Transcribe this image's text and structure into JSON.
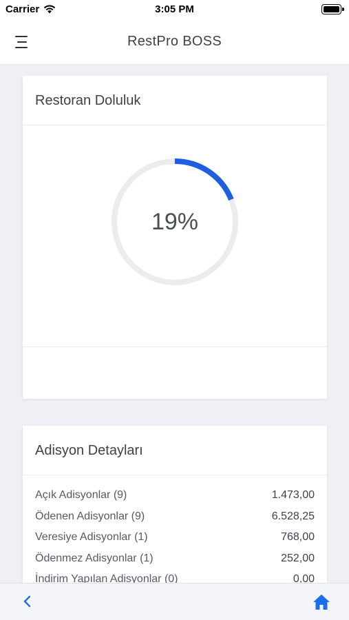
{
  "status_bar": {
    "carrier": "Carrier",
    "time": "3:05 PM"
  },
  "header": {
    "title": "RestPro BOSS"
  },
  "occupancy": {
    "title": "Restoran Doluluk",
    "percent_label": "19%",
    "percent_value": 19,
    "accent_color": "#1f5fdf",
    "track_color": "#ececec"
  },
  "details": {
    "title": "Adisyon Detayları",
    "rows": [
      {
        "label": "Açık Adisyonlar (9)",
        "value": "1.473,00"
      },
      {
        "label": "Ödenen Adisyonlar (9)",
        "value": "6.528,25"
      },
      {
        "label": "Veresiye Adisyonlar (1)",
        "value": "768,00"
      },
      {
        "label": "Ödenmez Adisyonlar (1)",
        "value": "252,00"
      },
      {
        "label": "İndirim Yapılan Adisyonlar (0)",
        "value": "0,00"
      }
    ]
  },
  "icons": {
    "menu": "menu-icon",
    "back": "chevron-left-icon",
    "home": "home-icon",
    "wifi": "wifi-icon",
    "battery": "battery-icon"
  }
}
